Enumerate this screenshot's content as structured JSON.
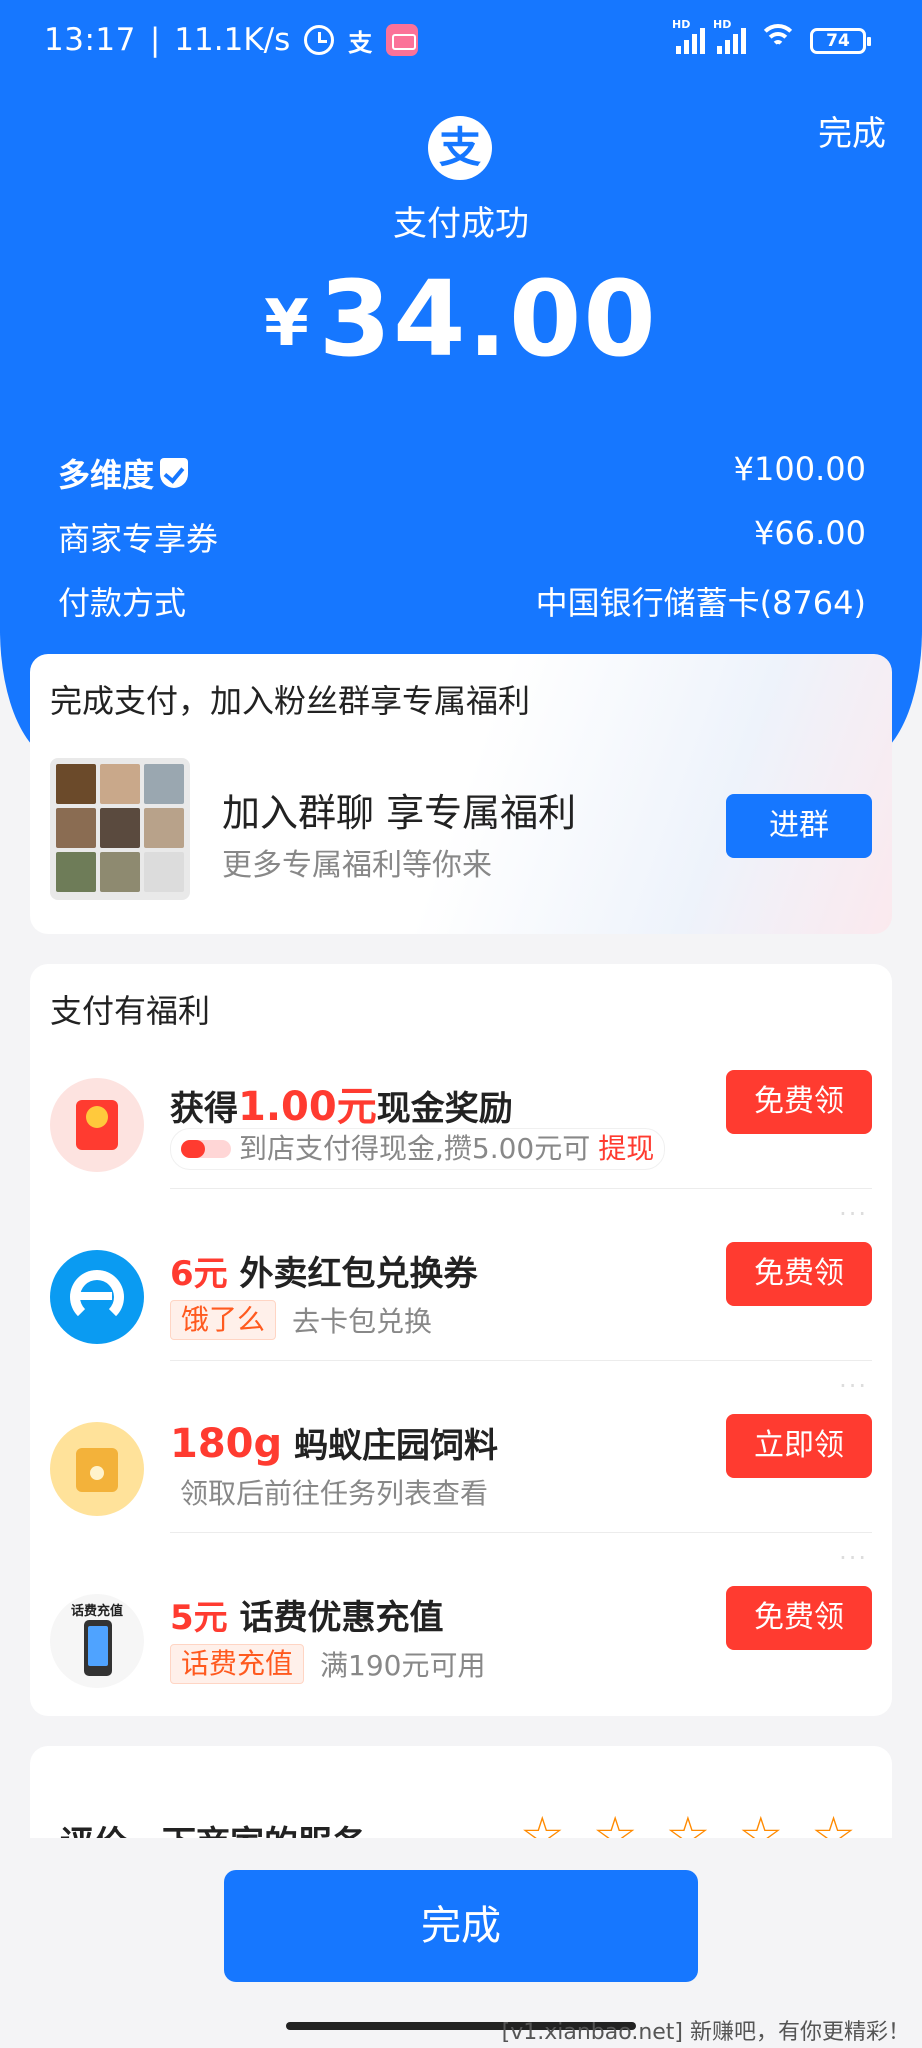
{
  "status_bar": {
    "time": "13:17",
    "speed": "11.1K/s",
    "separator": "|",
    "hd1": "HD",
    "hd2": "HD",
    "battery": "74"
  },
  "header": {
    "done_label": "完成",
    "logo_char": "支",
    "status_text": "支付成功",
    "currency": "¥",
    "amount": "34.00"
  },
  "details": {
    "merchant": "多维度",
    "merchant_amount": "¥100.00",
    "coupon_label": "商家专享券",
    "coupon_amount": "¥66.00",
    "method_label": "付款方式",
    "method_value": "中国银行储蓄卡(8764)"
  },
  "fans_group": {
    "title": "完成支付，加入粉丝群享专属福利",
    "group_title": "加入群聊 享专属福利",
    "group_subtitle": "更多专属福利等你来",
    "button": "进群"
  },
  "benefits": {
    "title": "支付有福利",
    "items": [
      {
        "title_pre": "获得",
        "title_hl": "1.00元",
        "title_post": "现金奖励",
        "sub_text": "到店支付得现金,攒5.00元可",
        "sub_hl": "提现",
        "button": "免费领"
      },
      {
        "title_hl": "6元",
        "title_post": "外卖红包兑换券",
        "tag": "饿了么",
        "sub_text": "去卡包兑换",
        "button": "免费领"
      },
      {
        "title_hl": "180g",
        "title_post": "蚂蚁庄园饲料",
        "sub_text": "领取后前往任务列表查看",
        "button": "立即领"
      },
      {
        "title_hl": "5元",
        "title_post": "话费优惠充值",
        "tag": "话费充值",
        "sub_text": "满190元可用",
        "icon_text": "话费充值",
        "button": "免费领"
      }
    ],
    "more": "···"
  },
  "rating": {
    "label": "评价一下商家的服务",
    "stars": [
      "☆",
      "☆",
      "☆",
      "☆",
      "☆"
    ]
  },
  "footer": {
    "done_button": "完成",
    "watermark": "[v1.xianbao.net] 新赚吧，有你更精彩！"
  },
  "colors": {
    "brand_blue": "#1677ff",
    "accent_red": "#ff3b30",
    "tag_orange": "#ff5a1f"
  }
}
